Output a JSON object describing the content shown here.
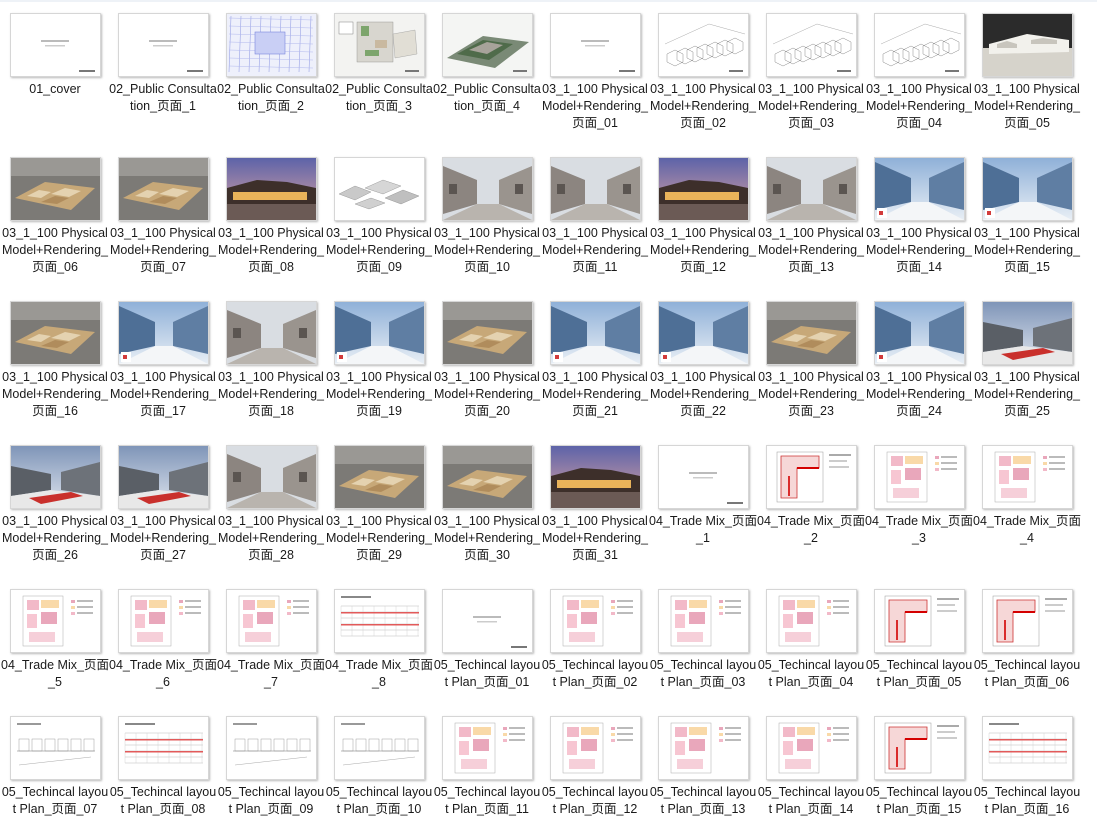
{
  "explorer": {
    "rows": [
      [
        {
          "label": "01_cover",
          "thumb": "blank-text"
        },
        {
          "label": "02_Public Consultation_页面_1",
          "thumb": "blank-text"
        },
        {
          "label": "02_Public Consultation_页面_2",
          "thumb": "site-plan-blue"
        },
        {
          "label": "02_Public Consultation_页面_3",
          "thumb": "site-plan-color"
        },
        {
          "label": "02_Public Consultation_页面_4",
          "thumb": "aerial-render"
        },
        {
          "label": "03_1_100 Physical Model+Rendering_页面_01",
          "thumb": "blank-text"
        },
        {
          "label": "03_1_100 Physical Model+Rendering_页面_02",
          "thumb": "line-sketch"
        },
        {
          "label": "03_1_100 Physical Model+Rendering_页面_03",
          "thumb": "line-sketch"
        },
        {
          "label": "03_1_100 Physical Model+Rendering_页面_04",
          "thumb": "line-sketch"
        },
        {
          "label": "03_1_100 Physical Model+Rendering_页面_05",
          "thumb": "model-white"
        }
      ],
      [
        {
          "label": "03_1_100 Physical Model+Rendering_页面_06",
          "thumb": "model-wood"
        },
        {
          "label": "03_1_100 Physical Model+Rendering_页面_07",
          "thumb": "model-wood"
        },
        {
          "label": "03_1_100 Physical Model+Rendering_页面_08",
          "thumb": "dusk-render"
        },
        {
          "label": "03_1_100 Physical Model+Rendering_页面_09",
          "thumb": "grey-massing"
        },
        {
          "label": "03_1_100 Physical Model+Rendering_页面_10",
          "thumb": "street-render"
        },
        {
          "label": "03_1_100 Physical Model+Rendering_页面_11",
          "thumb": "street-render"
        },
        {
          "label": "03_1_100 Physical Model+Rendering_页面_12",
          "thumb": "dusk-render"
        },
        {
          "label": "03_1_100 Physical Model+Rendering_页面_13",
          "thumb": "street-render"
        },
        {
          "label": "03_1_100 Physical Model+Rendering_页面_14",
          "thumb": "glass-street"
        },
        {
          "label": "03_1_100 Physical Model+Rendering_页面_15",
          "thumb": "glass-street"
        }
      ],
      [
        {
          "label": "03_1_100 Physical Model+Rendering_页面_16",
          "thumb": "model-wood"
        },
        {
          "label": "03_1_100 Physical Model+Rendering_页面_17",
          "thumb": "glass-street"
        },
        {
          "label": "03_1_100 Physical Model+Rendering_页面_18",
          "thumb": "street-render"
        },
        {
          "label": "03_1_100 Physical Model+Rendering_页面_19",
          "thumb": "glass-street"
        },
        {
          "label": "03_1_100 Physical Model+Rendering_页面_20",
          "thumb": "model-wood"
        },
        {
          "label": "03_1_100 Physical Model+Rendering_页面_21",
          "thumb": "glass-street"
        },
        {
          "label": "03_1_100 Physical Model+Rendering_页面_22",
          "thumb": "glass-street"
        },
        {
          "label": "03_1_100 Physical Model+Rendering_页面_23",
          "thumb": "model-wood"
        },
        {
          "label": "03_1_100 Physical Model+Rendering_页面_24",
          "thumb": "glass-street"
        },
        {
          "label": "03_1_100 Physical Model+Rendering_页面_25",
          "thumb": "red-accent"
        }
      ],
      [
        {
          "label": "03_1_100 Physical Model+Rendering_页面_26",
          "thumb": "red-accent"
        },
        {
          "label": "03_1_100 Physical Model+Rendering_页面_27",
          "thumb": "red-accent"
        },
        {
          "label": "03_1_100 Physical Model+Rendering_页面_28",
          "thumb": "street-render"
        },
        {
          "label": "03_1_100 Physical Model+Rendering_页面_29",
          "thumb": "model-wood"
        },
        {
          "label": "03_1_100 Physical Model+Rendering_页面_30",
          "thumb": "model-wood"
        },
        {
          "label": "03_1_100 Physical Model+Rendering_页面_31",
          "thumb": "dusk-render"
        },
        {
          "label": "04_Trade Mix_页面_1",
          "thumb": "blank-text"
        },
        {
          "label": "04_Trade Mix_页面_2",
          "thumb": "plan-red"
        },
        {
          "label": "04_Trade Mix_页面_3",
          "thumb": "plan-pink"
        },
        {
          "label": "04_Trade Mix_页面_4",
          "thumb": "plan-pink"
        }
      ],
      [
        {
          "label": "04_Trade Mix_页面_5",
          "thumb": "plan-pink"
        },
        {
          "label": "04_Trade Mix_页面_6",
          "thumb": "plan-pink"
        },
        {
          "label": "04_Trade Mix_页面_7",
          "thumb": "plan-pink"
        },
        {
          "label": "04_Trade Mix_页面_8",
          "thumb": "table-sheet"
        },
        {
          "label": "05_Techincal layout Plan_页面_01",
          "thumb": "blank-text"
        },
        {
          "label": "05_Techincal layout Plan_页面_02",
          "thumb": "plan-pink"
        },
        {
          "label": "05_Techincal layout Plan_页面_03",
          "thumb": "plan-pink"
        },
        {
          "label": "05_Techincal layout Plan_页面_04",
          "thumb": "plan-pink"
        },
        {
          "label": "05_Techincal layout Plan_页面_05",
          "thumb": "plan-red"
        },
        {
          "label": "05_Techincal layout Plan_页面_06",
          "thumb": "plan-red"
        }
      ],
      [
        {
          "label": "05_Techincal layout Plan_页面_07",
          "thumb": "section-sketch"
        },
        {
          "label": "05_Techincal layout Plan_页面_08",
          "thumb": "table-sheet"
        },
        {
          "label": "05_Techincal layout Plan_页面_09",
          "thumb": "section-sketch"
        },
        {
          "label": "05_Techincal layout Plan_页面_10",
          "thumb": "section-sketch"
        },
        {
          "label": "05_Techincal layout Plan_页面_11",
          "thumb": "plan-pink"
        },
        {
          "label": "05_Techincal layout Plan_页面_12",
          "thumb": "plan-pink"
        },
        {
          "label": "05_Techincal layout Plan_页面_13",
          "thumb": "plan-pink"
        },
        {
          "label": "05_Techincal layout Plan_页面_14",
          "thumb": "plan-pink"
        },
        {
          "label": "05_Techincal layout Plan_页面_15",
          "thumb": "plan-red"
        },
        {
          "label": "05_Techincal layout Plan_页面_16",
          "thumb": "table-sheet"
        }
      ]
    ]
  }
}
